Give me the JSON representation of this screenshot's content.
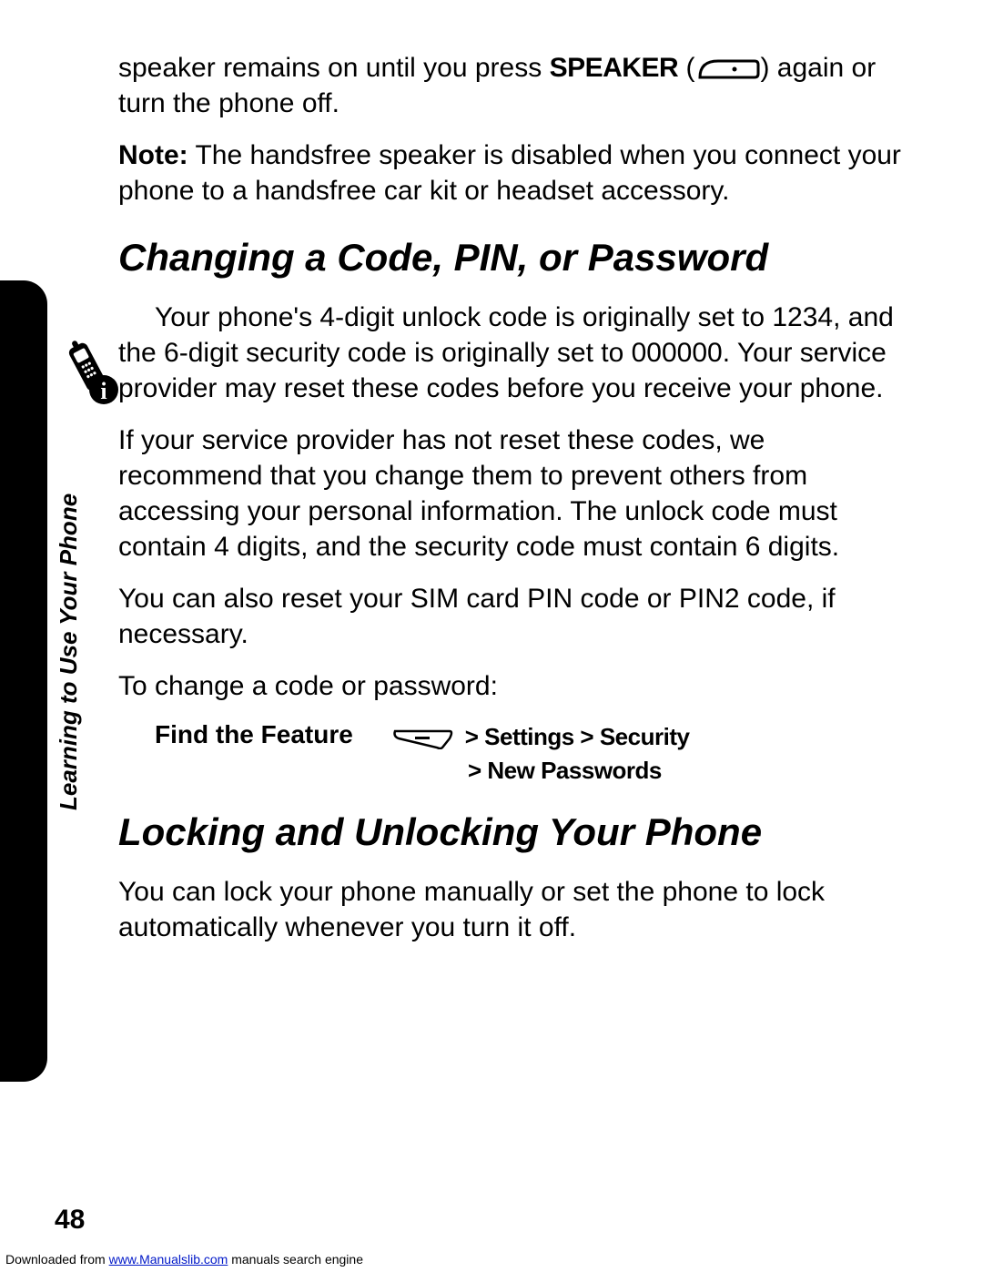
{
  "intro": {
    "p1_a": "speaker remains on until you press ",
    "p1_speaker": "SPEAKER",
    "p1_b": " again or turn the phone off.",
    "note_label": "Note:",
    "note_body": " The handsfree speaker is disabled when you connect your phone to a handsfree car kit or headset accessory."
  },
  "section1": {
    "heading": "Changing a Code, PIN, or Password",
    "p1": "Your phone's 4-digit unlock code is originally set to 1234, and the 6-digit security code is originally set to 000000. Your service provider may reset these codes before you receive your phone.",
    "p2": "If your service provider has not reset these codes, we recommend that you change them to prevent others from accessing your personal information. The unlock code must contain 4 digits, and the security code must contain 6 digits.",
    "p3": "You can also reset your SIM card PIN code or PIN2 code, if necessary.",
    "p4": "To change a code or password:"
  },
  "feature": {
    "label": "Find the Feature",
    "path1a": "> Settings > Security",
    "path2": "> New Passwords"
  },
  "section2": {
    "heading": "Locking and Unlocking Your Phone",
    "p1": "You can lock your phone manually or set the phone to lock automatically whenever you turn it off."
  },
  "side_label": "Learning to Use Your Phone",
  "page_number": "48",
  "footer": {
    "prefix": "Downloaded from ",
    "link_text": "www.Manualslib.com",
    "link_href": "http://www.Manualslib.com",
    "suffix": " manuals search engine"
  }
}
